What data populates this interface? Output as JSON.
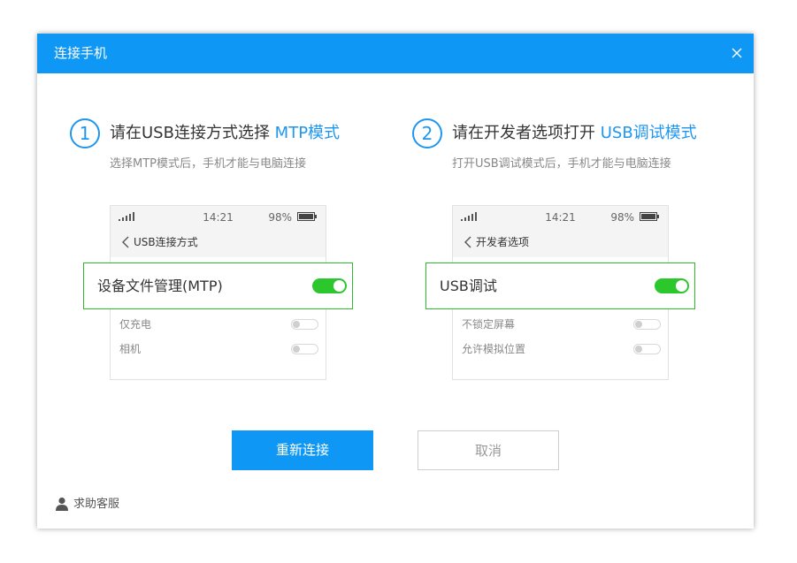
{
  "dialog": {
    "title": "连接手机",
    "close_icon": "close-icon"
  },
  "colors": {
    "accent": "#0e97f5",
    "highlight_border": "#2dbb2d",
    "toggle_on": "#2cc72c"
  },
  "steps": [
    {
      "number": "1",
      "title_prefix": "请在USB连接方式选择 ",
      "title_highlight": "MTP模式",
      "subtitle": "选择MTP模式后，手机才能与电脑连接",
      "phone": {
        "time": "14:21",
        "battery": "98%",
        "nav_title": "USB连接方式",
        "highlight_option": "设备文件管理(MTP)",
        "highlight_on": true,
        "options": [
          {
            "label": "仅充电",
            "on": false
          },
          {
            "label": "相机",
            "on": false
          }
        ]
      }
    },
    {
      "number": "2",
      "title_prefix": "请在开发者选项打开 ",
      "title_highlight": "USB调试模式",
      "subtitle": "打开USB调试模式后，手机才能与电脑连接",
      "phone": {
        "time": "14:21",
        "battery": "98%",
        "nav_title": "开发者选项",
        "highlight_option": "USB调试",
        "highlight_on": true,
        "options": [
          {
            "label": "不锁定屏幕",
            "on": false
          },
          {
            "label": "允许模拟位置",
            "on": false
          }
        ]
      }
    }
  ],
  "actions": {
    "reconnect_label": "重新连接",
    "cancel_label": "取消"
  },
  "help": {
    "label": "求助客服",
    "icon": "user-icon"
  }
}
